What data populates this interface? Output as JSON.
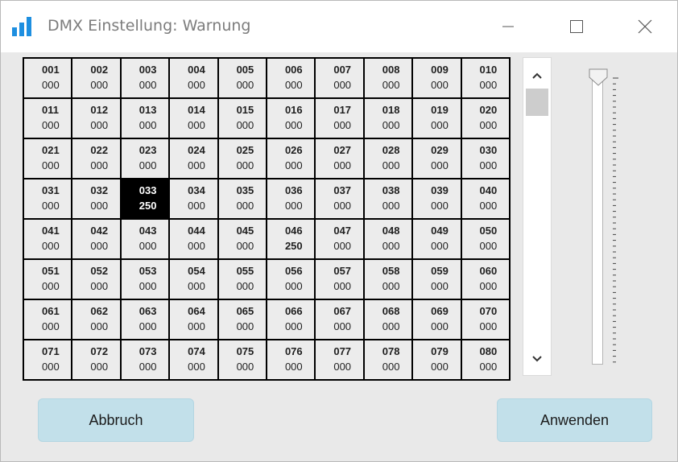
{
  "window": {
    "title": "DMX Einstellung: Warnung"
  },
  "titlebar_buttons": {
    "minimize_icon": "minimize-icon",
    "maximize_icon": "maximize-icon",
    "close_icon": "close-icon"
  },
  "grid": {
    "rows": [
      [
        {
          "ch": "001",
          "val": "000"
        },
        {
          "ch": "002",
          "val": "000"
        },
        {
          "ch": "003",
          "val": "000"
        },
        {
          "ch": "004",
          "val": "000"
        },
        {
          "ch": "005",
          "val": "000"
        },
        {
          "ch": "006",
          "val": "000"
        },
        {
          "ch": "007",
          "val": "000"
        },
        {
          "ch": "008",
          "val": "000"
        },
        {
          "ch": "009",
          "val": "000"
        },
        {
          "ch": "010",
          "val": "000"
        }
      ],
      [
        {
          "ch": "011",
          "val": "000"
        },
        {
          "ch": "012",
          "val": "000"
        },
        {
          "ch": "013",
          "val": "000"
        },
        {
          "ch": "014",
          "val": "000"
        },
        {
          "ch": "015",
          "val": "000"
        },
        {
          "ch": "016",
          "val": "000"
        },
        {
          "ch": "017",
          "val": "000"
        },
        {
          "ch": "018",
          "val": "000"
        },
        {
          "ch": "019",
          "val": "000"
        },
        {
          "ch": "020",
          "val": "000"
        }
      ],
      [
        {
          "ch": "021",
          "val": "000"
        },
        {
          "ch": "022",
          "val": "000"
        },
        {
          "ch": "023",
          "val": "000"
        },
        {
          "ch": "024",
          "val": "000"
        },
        {
          "ch": "025",
          "val": "000"
        },
        {
          "ch": "026",
          "val": "000"
        },
        {
          "ch": "027",
          "val": "000"
        },
        {
          "ch": "028",
          "val": "000"
        },
        {
          "ch": "029",
          "val": "000"
        },
        {
          "ch": "030",
          "val": "000"
        }
      ],
      [
        {
          "ch": "031",
          "val": "000"
        },
        {
          "ch": "032",
          "val": "000"
        },
        {
          "ch": "033",
          "val": "250",
          "selected": true
        },
        {
          "ch": "034",
          "val": "000"
        },
        {
          "ch": "035",
          "val": "000"
        },
        {
          "ch": "036",
          "val": "000"
        },
        {
          "ch": "037",
          "val": "000"
        },
        {
          "ch": "038",
          "val": "000"
        },
        {
          "ch": "039",
          "val": "000"
        },
        {
          "ch": "040",
          "val": "000"
        }
      ],
      [
        {
          "ch": "041",
          "val": "000"
        },
        {
          "ch": "042",
          "val": "000"
        },
        {
          "ch": "043",
          "val": "000"
        },
        {
          "ch": "044",
          "val": "000"
        },
        {
          "ch": "045",
          "val": "000"
        },
        {
          "ch": "046",
          "val": "250",
          "emph": true
        },
        {
          "ch": "047",
          "val": "000"
        },
        {
          "ch": "048",
          "val": "000"
        },
        {
          "ch": "049",
          "val": "000"
        },
        {
          "ch": "050",
          "val": "000"
        }
      ],
      [
        {
          "ch": "051",
          "val": "000"
        },
        {
          "ch": "052",
          "val": "000"
        },
        {
          "ch": "053",
          "val": "000"
        },
        {
          "ch": "054",
          "val": "000"
        },
        {
          "ch": "055",
          "val": "000"
        },
        {
          "ch": "056",
          "val": "000"
        },
        {
          "ch": "057",
          "val": "000"
        },
        {
          "ch": "058",
          "val": "000"
        },
        {
          "ch": "059",
          "val": "000"
        },
        {
          "ch": "060",
          "val": "000"
        }
      ],
      [
        {
          "ch": "061",
          "val": "000"
        },
        {
          "ch": "062",
          "val": "000"
        },
        {
          "ch": "063",
          "val": "000"
        },
        {
          "ch": "064",
          "val": "000"
        },
        {
          "ch": "065",
          "val": "000"
        },
        {
          "ch": "066",
          "val": "000"
        },
        {
          "ch": "067",
          "val": "000"
        },
        {
          "ch": "068",
          "val": "000"
        },
        {
          "ch": "069",
          "val": "000"
        },
        {
          "ch": "070",
          "val": "000"
        }
      ],
      [
        {
          "ch": "071",
          "val": "000"
        },
        {
          "ch": "072",
          "val": "000"
        },
        {
          "ch": "073",
          "val": "000"
        },
        {
          "ch": "074",
          "val": "000"
        },
        {
          "ch": "075",
          "val": "000"
        },
        {
          "ch": "076",
          "val": "000"
        },
        {
          "ch": "077",
          "val": "000"
        },
        {
          "ch": "078",
          "val": "000"
        },
        {
          "ch": "079",
          "val": "000"
        },
        {
          "ch": "080",
          "val": "000"
        }
      ]
    ]
  },
  "value_slider": {
    "value_fraction": 1.0
  },
  "buttons": {
    "cancel_label": "Abbruch",
    "apply_label": "Anwenden"
  },
  "colors": {
    "accent": "#1e8fe0",
    "button_bg": "#c2e0ea",
    "selected_cell_bg": "#000000"
  }
}
